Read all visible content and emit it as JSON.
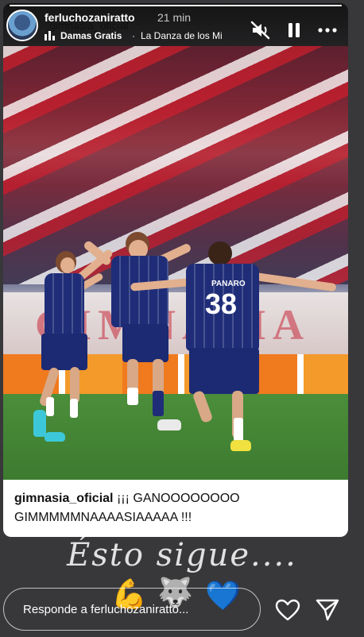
{
  "story": {
    "username": "ferluchozaniratto",
    "time_ago": "21 min",
    "overlay_name": "gimnasia_oficial",
    "music": {
      "artist": "Damas Gratis",
      "title": "La Danza de los Mi"
    },
    "progress": 1.0,
    "icons": {
      "mute": "mute-icon",
      "pause": "pause-icon",
      "more": "more-icon",
      "music": "music-note-icon",
      "heart": "heart-icon",
      "send": "send-icon"
    }
  },
  "photo": {
    "banner_text": "GIMNASIA",
    "player_number": "38",
    "player_name": "PANARO"
  },
  "caption": {
    "user": "gimnasia_oficial",
    "text": " ¡¡¡ GANOOOOOOOO GIMMMMMNAAAASIAAAAA !!!"
  },
  "overlay_text": "Ésto sigue....",
  "emojis": [
    "💪",
    "🐺",
    "💙"
  ],
  "reply": {
    "placeholder": "Responde a ferluchozaniratto..."
  }
}
